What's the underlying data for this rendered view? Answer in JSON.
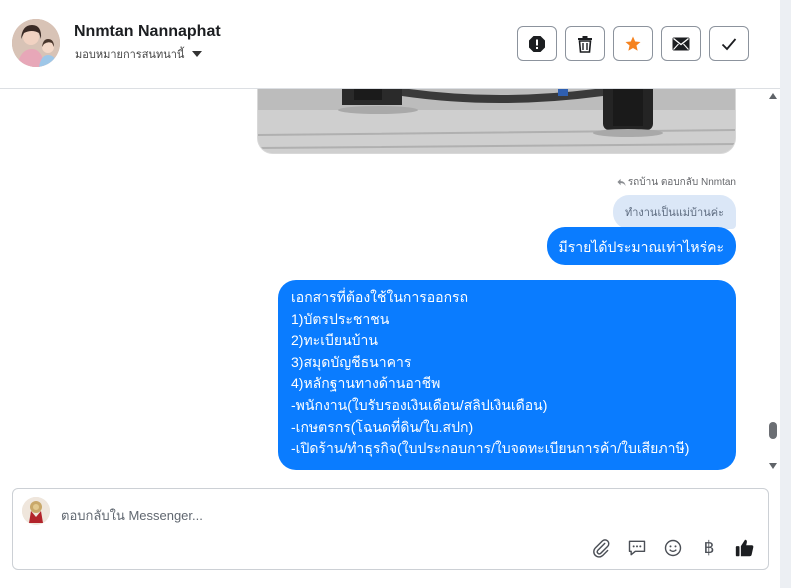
{
  "header": {
    "contact_name": "Nnmtan Nannaphat",
    "assign_label": "มอบหมายการสนทนานี้",
    "actions": [
      {
        "icon": "alert-icon"
      },
      {
        "icon": "trash-icon"
      },
      {
        "icon": "star-icon",
        "color": "#f5821f"
      },
      {
        "icon": "envelope-icon"
      },
      {
        "icon": "check-icon"
      }
    ]
  },
  "conversation": {
    "reply_meta": "รถบ้าน ตอบกลับ Nnmtan",
    "quoted_message": "ทำงานเป็นแม่บ้านค่ะ",
    "messages": [
      {
        "text": "มีรายได้ประมาณเท่าไหร่คะ"
      },
      {
        "lines": [
          "เอกสารที่ต้องใช้ในการออกรถ",
          "1)บัตรประชาชน",
          "2)ทะเบียนบ้าน",
          "3)สมุดบัญชีธนาคาร",
          "4)หลักฐานทางด้านอาชีพ",
          "-พนักงาน(ใบรับรองเงินเดือน/สลิปเงินเดือน)",
          "-เกษตรกร(โฉนดที่ดิน/ใบ.สปก)",
          "-เปิดร้าน/ทำธุรกิจ(ใบประกอบการ/ใบจดทะเบียนการค้า/ใบเสียภาษี)"
        ]
      }
    ],
    "bubble_color": "#0a7cff"
  },
  "composer": {
    "placeholder": "ตอบกลับใน Messenger...",
    "tools": [
      "paperclip-icon",
      "chat-bubble-icon",
      "emoji-icon",
      "baht-icon",
      "thumbs-up-icon"
    ],
    "baht_symbol": "฿"
  }
}
